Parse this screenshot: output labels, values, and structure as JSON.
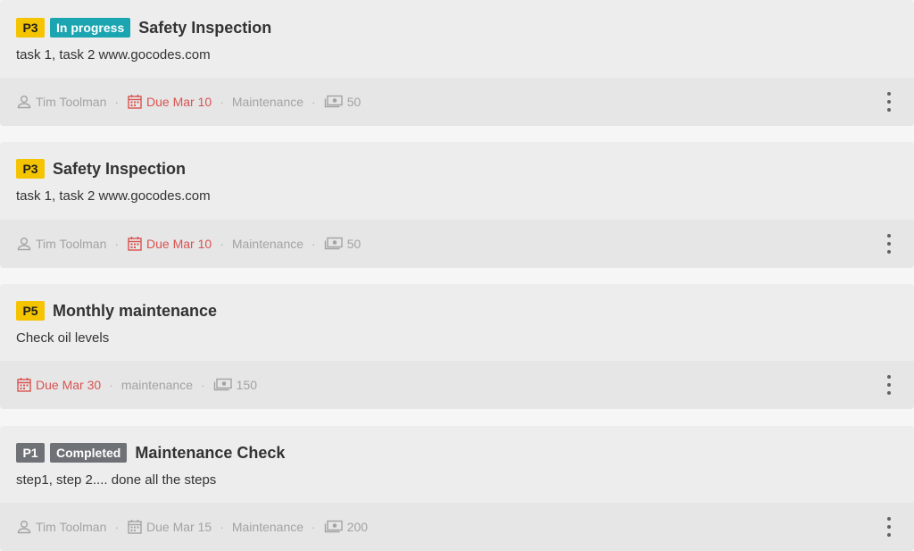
{
  "colors": {
    "priority_yellow": "#f5c400",
    "status_in_progress": "#1aa5b0",
    "status_completed": "#6e7277",
    "due_overdue": "#d9534f",
    "meta_text": "#a3a3a3"
  },
  "work_orders": [
    {
      "priority": "P3",
      "status": "In progress",
      "title": "Safety Inspection",
      "description": "task 1, task 2 www.gocodes.com",
      "assignee": "Tim Toolman",
      "due": "Due Mar 10",
      "category": "Maintenance",
      "cost": "50"
    },
    {
      "priority": "P3",
      "status": "",
      "title": "Safety Inspection",
      "description": "task 1, task 2 www.gocodes.com",
      "assignee": "Tim Toolman",
      "due": "Due Mar 10",
      "category": "Maintenance",
      "cost": "50"
    },
    {
      "priority": "P5",
      "status": "",
      "title": "Monthly maintenance",
      "description": "Check oil levels",
      "assignee": "",
      "due": "Due Mar 30",
      "category": "maintenance",
      "cost": "150"
    },
    {
      "priority": "P1",
      "status": "Completed",
      "title": "Maintenance Check",
      "description": "step1, step 2.... done all the steps",
      "assignee": "Tim Toolman",
      "due": "Due Mar 15",
      "category": "Maintenance",
      "cost": "200"
    }
  ],
  "icons": {
    "assignee": "user-icon",
    "due": "calendar-icon",
    "cost": "money-icon",
    "menu": "more-vertical-icon"
  }
}
